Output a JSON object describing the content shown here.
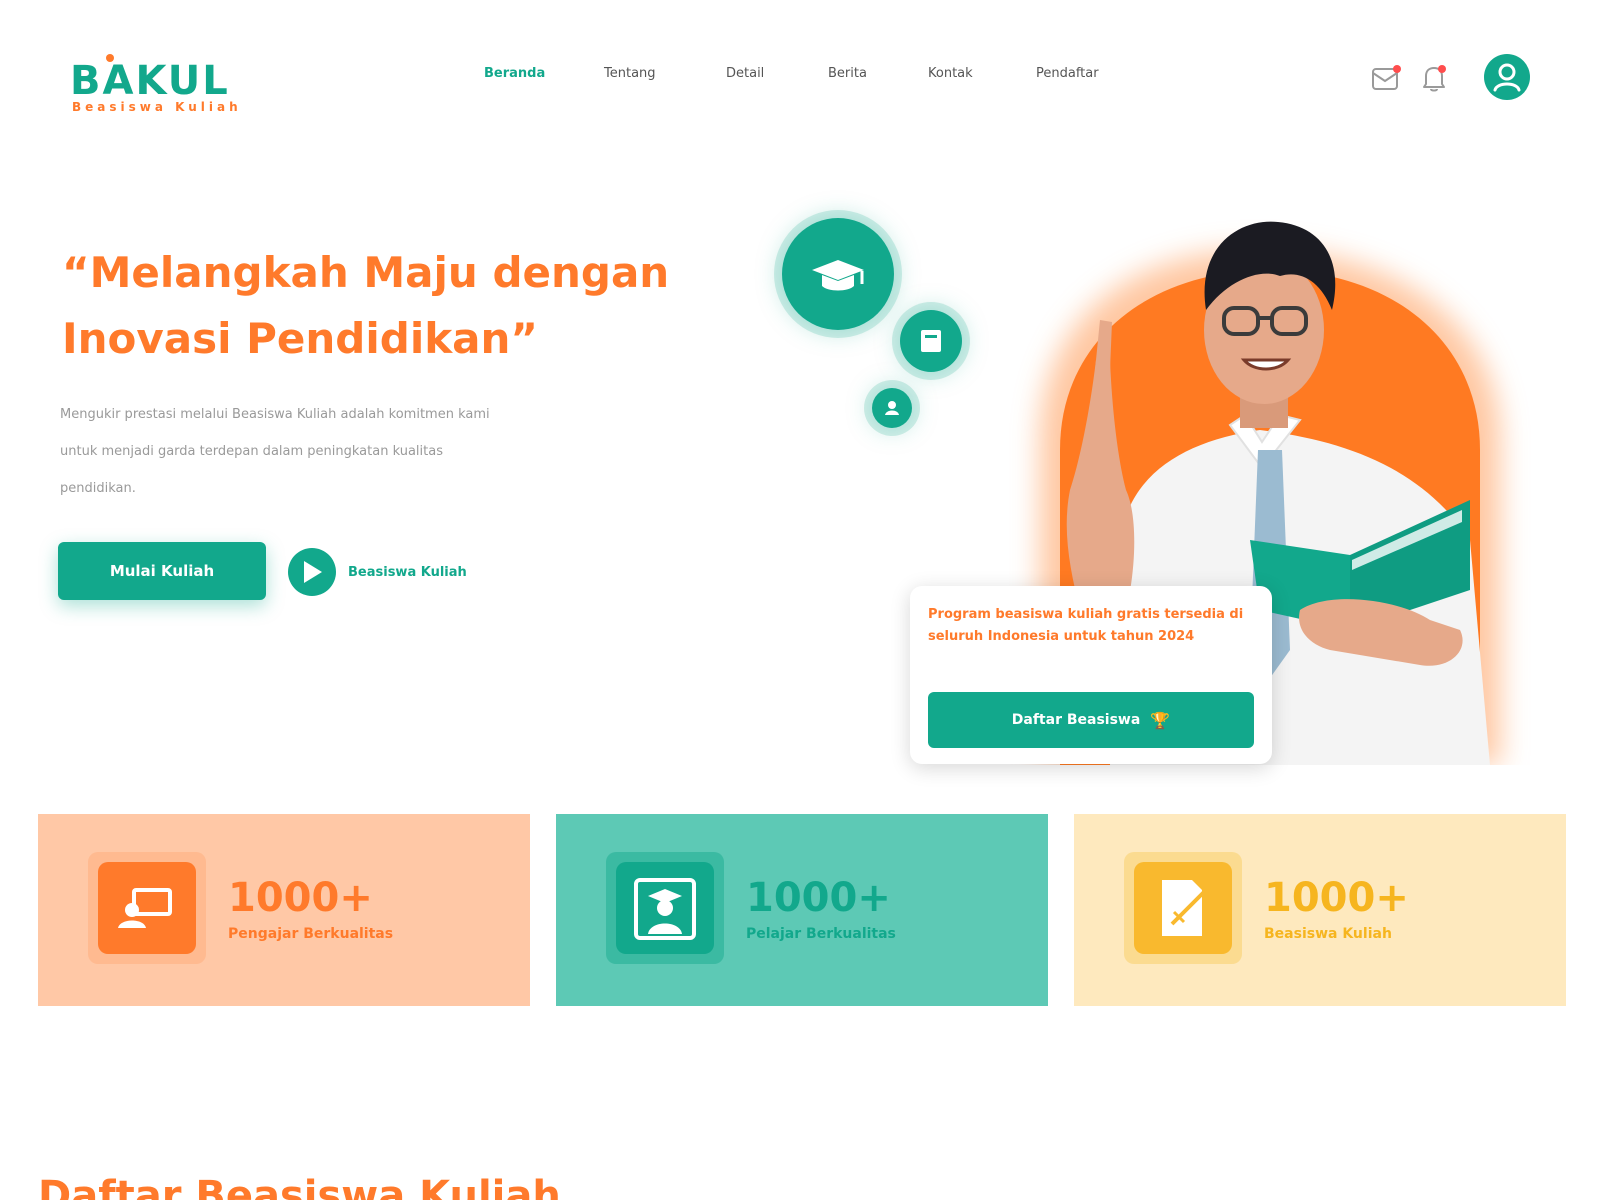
{
  "brand": {
    "name": "BAKUL",
    "tagline": "Beasiswa Kuliah",
    "primary_color": "#12a88c",
    "accent_color": "#ff7a2b"
  },
  "nav": {
    "items": [
      {
        "label": "Beranda",
        "active": true
      },
      {
        "label": "Tentang",
        "active": false
      },
      {
        "label": "Detail",
        "active": false
      },
      {
        "label": "Berita",
        "active": false
      },
      {
        "label": "Kontak",
        "active": false
      },
      {
        "label": "Pendaftar",
        "active": false
      }
    ]
  },
  "header_icons": [
    "message-icon",
    "bell-icon",
    "user-avatar-icon"
  ],
  "hero": {
    "title": "“Melangkah Maju dengan Inovasi Pendidikan”",
    "description": "Mengukir prestasi melalui Beasiswa Kuliah adalah komitmen kami untuk menjadi garda terdepan dalam peningkatan kualitas pendidikan.",
    "cta_label": "Mulai Kuliah",
    "video_label": "Beasiswa Kuliah"
  },
  "scholarship_card": {
    "text": "Program beasiswa kuliah gratis tersedia di seluruh Indonesia untuk tahun 2024",
    "button_label": "Daftar Beasiswa"
  },
  "stats": [
    {
      "value": "1000+",
      "label": "Pengajar Berkualitas",
      "icon": "teacher-icon"
    },
    {
      "value": "1000+",
      "label": "Pelajar Berkualitas",
      "icon": "graduate-icon"
    },
    {
      "value": "1000+",
      "label": "Beasiswa Kuliah",
      "icon": "certificate-icon"
    }
  ],
  "section": {
    "title": "Daftar Beasiswa Kuliah"
  }
}
